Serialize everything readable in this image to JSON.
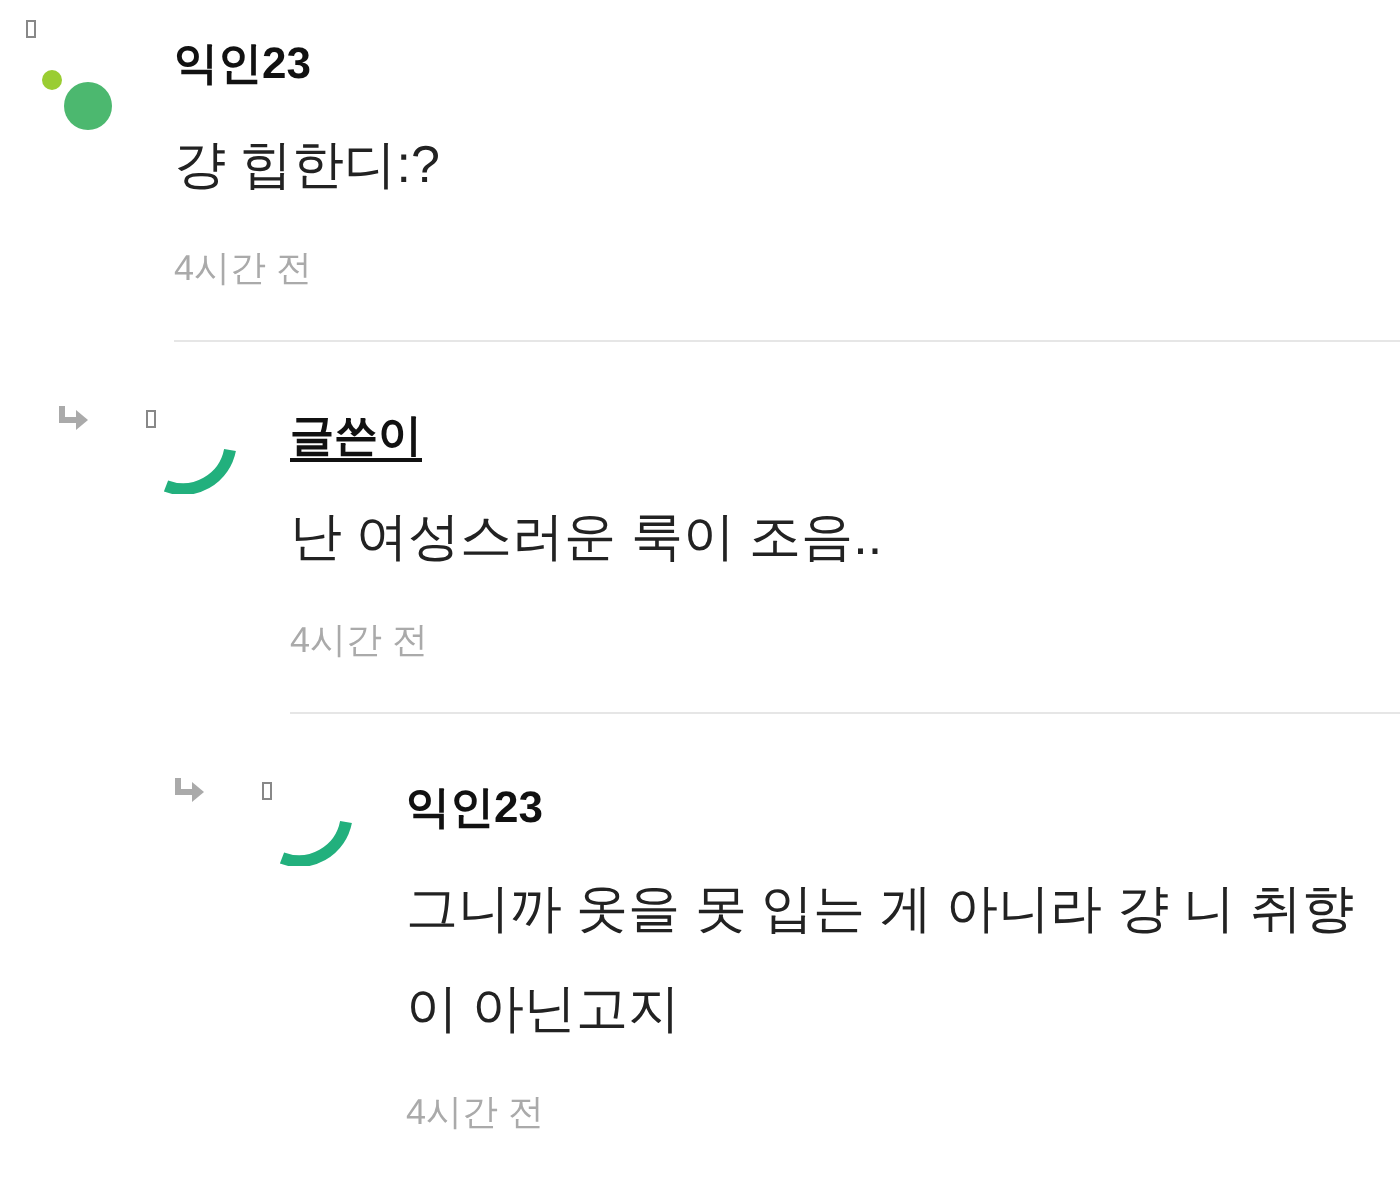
{
  "comments": [
    {
      "author": "익인23",
      "is_writer": false,
      "kind": "dots",
      "body": "걍 힙한디:?",
      "time": "4시간 전",
      "children": [
        {
          "author": "글쓴이",
          "is_writer": true,
          "kind": "arc",
          "body": "난 여성스러운 룩이 조음..",
          "time": "4시간 전",
          "children": [
            {
              "author": "익인23",
              "is_writer": false,
              "kind": "arc",
              "body": "그니까 옷을 못 입는 게 아니라 걍 니 취향이 아닌고지",
              "time": "4시간 전"
            }
          ]
        }
      ]
    }
  ]
}
